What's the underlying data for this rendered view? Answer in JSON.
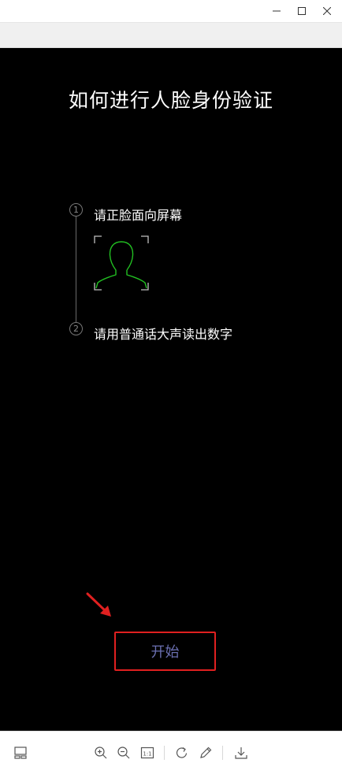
{
  "window": {
    "minimize_icon": "minimize-icon",
    "maximize_icon": "maximize-icon",
    "close_icon": "close-icon"
  },
  "content": {
    "title": "如何进行人脸身份验证",
    "steps": [
      {
        "number": "1",
        "text": "请正脸面向屏幕"
      },
      {
        "number": "2",
        "text": "请用普通话大声读出数字"
      }
    ],
    "face_icon": "face-outline-icon",
    "face_color": "#22c022",
    "start_button_label": "开始",
    "annotation_color": "#e02020"
  },
  "toolbar": {
    "icons": [
      "layout-icon",
      "zoom-in-icon",
      "zoom-out-icon",
      "actual-size-icon",
      "rotate-icon",
      "edit-pen-icon",
      "download-icon"
    ],
    "actual_size_label": "1:1"
  }
}
